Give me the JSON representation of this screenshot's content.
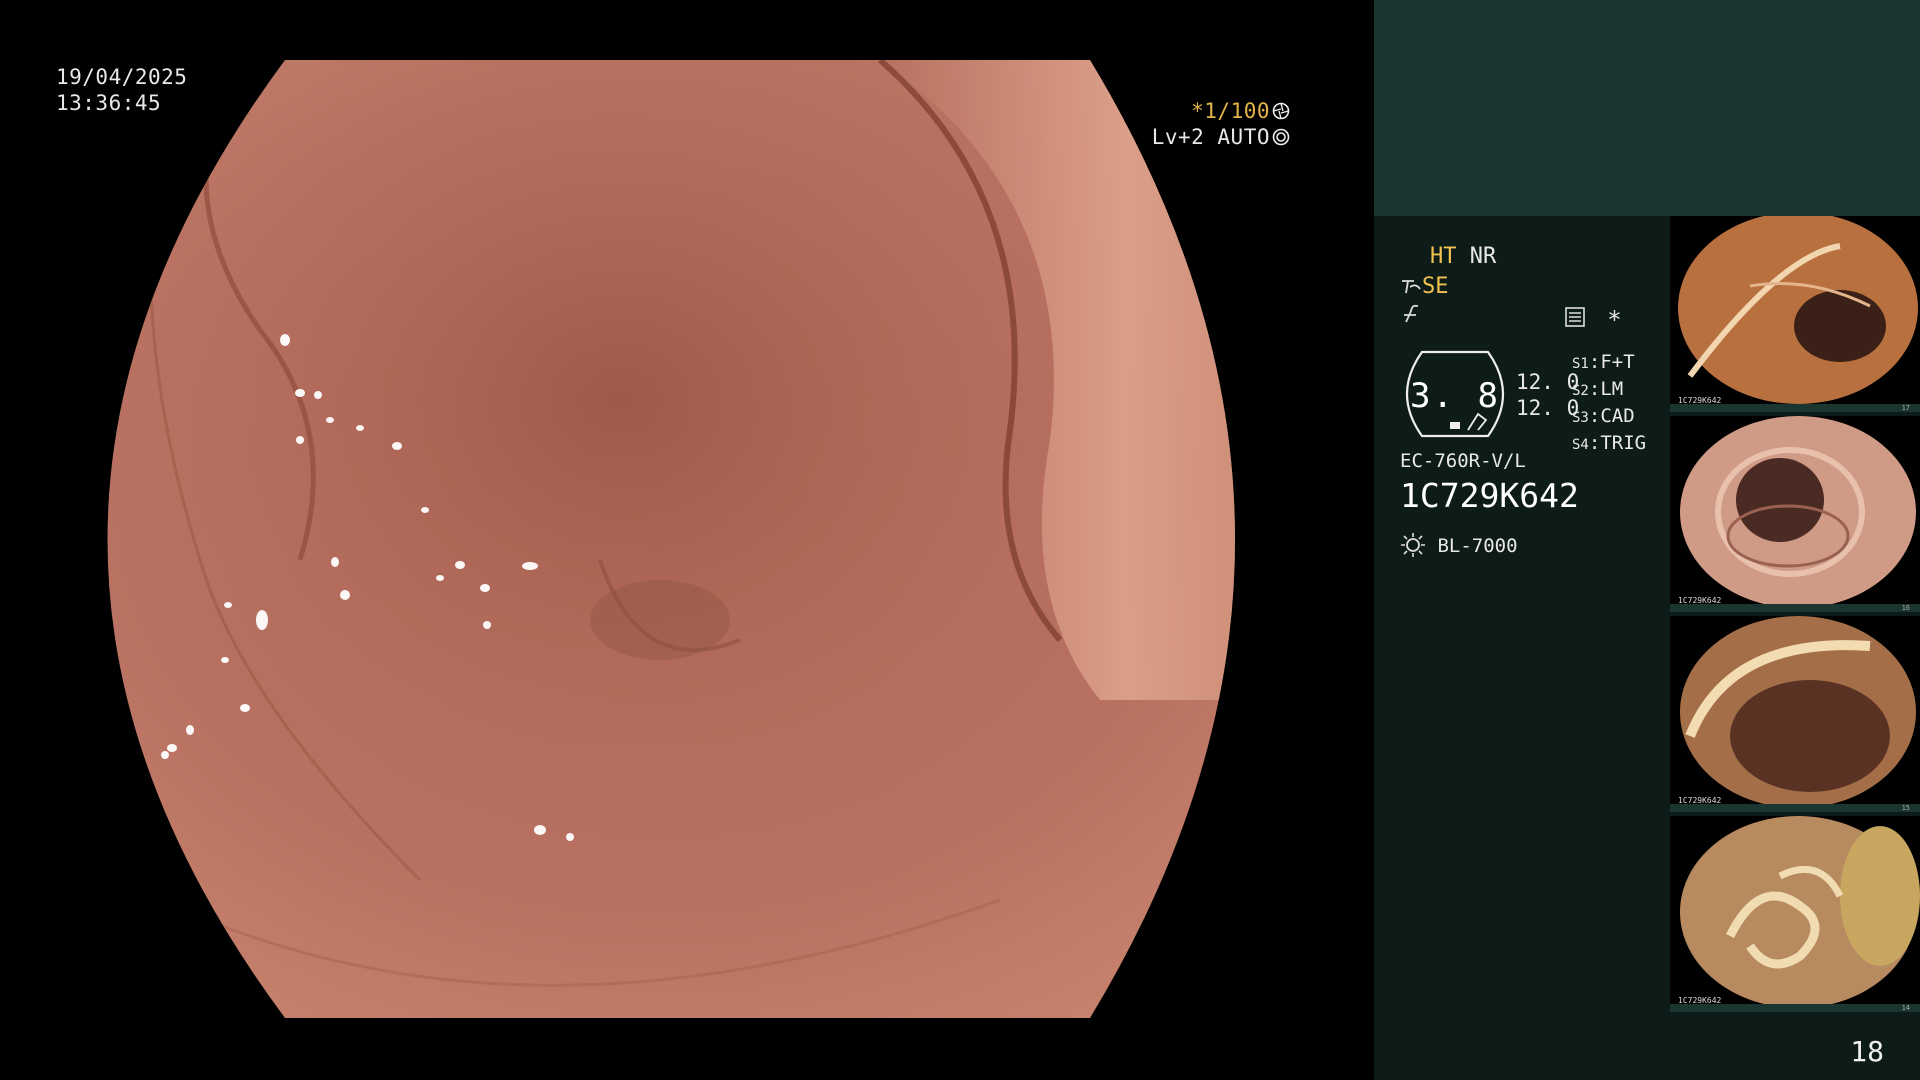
{
  "overlay": {
    "date": "19/04/2025",
    "time": "13:36:45",
    "shutter": "*1/100",
    "level": "Lv+2 AUTO"
  },
  "panel": {
    "mode_ht": "HT",
    "mode_nr": "NR",
    "mode_se": "SE",
    "asterisk": "*",
    "hold_value": "3. 8",
    "value_top": "12. 0",
    "value_bottom": "12. 0",
    "switches": [
      {
        "key": "S1",
        "value": "F+T"
      },
      {
        "key": "S2",
        "value": "LM"
      },
      {
        "key": "S3",
        "value": "CAD"
      },
      {
        "key": "S4",
        "value": "TRIG"
      }
    ],
    "scope_model": "EC-760R-V/L",
    "scope_serial": "1C729K642",
    "light_source": "BL-7000"
  },
  "thumbnails": [
    {
      "name": "thumbnail-1",
      "serial": "1C729K642",
      "index": "17",
      "tone": "#c07a4a"
    },
    {
      "name": "thumbnail-2",
      "serial": "1C729K642",
      "index": "16",
      "tone": "#c99078"
    },
    {
      "name": "thumbnail-3",
      "serial": "1C729K642",
      "index": "15",
      "tone": "#a06a46"
    },
    {
      "name": "thumbnail-4",
      "serial": "1C729K642",
      "index": "14",
      "tone": "#b88a60"
    }
  ],
  "page_number": "18",
  "colors": {
    "panel_bg": "#0e1c19",
    "panel_header": "#1b3530",
    "accent": "#f2c24e",
    "mucosa": "#b8705e"
  }
}
